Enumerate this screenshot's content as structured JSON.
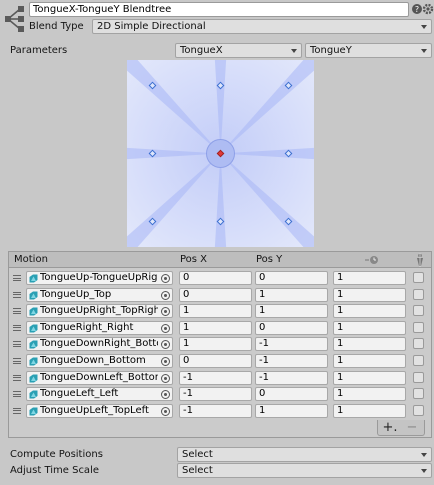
{
  "header": {
    "name": "TongueX-TongueY Blendtree",
    "blend_type_label": "Blend Type",
    "blend_type_value": "2D Simple Directional"
  },
  "parameters": {
    "label": "Parameters",
    "x_param": "TongueX",
    "y_param": "TongueY"
  },
  "blend_space": {
    "background": "#dde3f9",
    "ray_color": "#a8b6f5",
    "point_color": "#3b6fd0",
    "selected_color": "#e03838"
  },
  "table": {
    "columns": [
      "Motion",
      "Pos X",
      "Pos Y"
    ],
    "rows": [
      {
        "motion": "TongueUp-TongueUpRight",
        "pos_x": "0",
        "pos_y": "0",
        "speed": "1"
      },
      {
        "motion": "TongueUp_Top",
        "pos_x": "0",
        "pos_y": "1",
        "speed": "1"
      },
      {
        "motion": "TongueUpRight_TopRight",
        "pos_x": "1",
        "pos_y": "1",
        "speed": "1"
      },
      {
        "motion": "TongueRight_Right",
        "pos_x": "1",
        "pos_y": "0",
        "speed": "1"
      },
      {
        "motion": "TongueDownRight_BottomRight",
        "pos_x": "1",
        "pos_y": "-1",
        "speed": "1"
      },
      {
        "motion": "TongueDown_Bottom",
        "pos_x": "0",
        "pos_y": "-1",
        "speed": "1"
      },
      {
        "motion": "TongueDownLeft_BottomLeft",
        "pos_x": "-1",
        "pos_y": "-1",
        "speed": "1"
      },
      {
        "motion": "TongueLeft_Left",
        "pos_x": "-1",
        "pos_y": "0",
        "speed": "1"
      },
      {
        "motion": "TongueUpLeft_TopLeft",
        "pos_x": "-1",
        "pos_y": "1",
        "speed": "1"
      }
    ],
    "add_label": "+.",
    "remove_label": "−"
  },
  "footer": {
    "compute_positions_label": "Compute Positions",
    "compute_positions_value": "Select",
    "adjust_time_scale_label": "Adjust Time Scale",
    "adjust_time_scale_value": "Select"
  },
  "icons": {
    "logo": "blend-tree-icon",
    "help": "help-icon",
    "settings": "gear-icon",
    "speed_header": "clock-icon",
    "mirror_header": "mirror-figure-icon",
    "motion": "animation-clip-icon",
    "picker": "object-picker-icon"
  }
}
